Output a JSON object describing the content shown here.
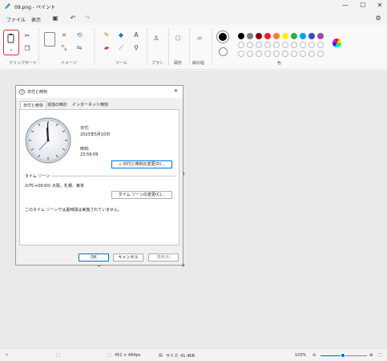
{
  "window": {
    "title": "09.png - ペイント",
    "minimize": "—",
    "maximize": "☐",
    "close": "✕"
  },
  "menu": {
    "file": "ファイル",
    "view": "表示"
  },
  "ribbon": {
    "groups": {
      "clipboard": "クリップボード",
      "image": "イメージ",
      "tools": "ツール",
      "brushes": "ブラシ",
      "shapes": "図形",
      "size": "線の幅",
      "colors": "色"
    },
    "palette_row1": [
      "#000000",
      "#7f7f7f",
      "#880015",
      "#ed1c24",
      "#ff7f27",
      "#fff200",
      "#22b14c",
      "#00a2e8",
      "#3f48cc",
      "#a349a4"
    ],
    "palette_row2_empty_count": 10
  },
  "dialog": {
    "title": "日付と時刻",
    "close": "✕",
    "tabs": [
      "日付と時刻",
      "追加の時計",
      "インターネット時刻"
    ],
    "date_label": "日付:",
    "date_value": "2023年5月10日",
    "time_label": "時刻:",
    "time_value": "23:59:09",
    "change_datetime_button": "日付と時刻の変更(D)...",
    "timezone_section": "タイム ゾーン",
    "timezone_value": "(UTC+09:00) 大阪、札幌、東京",
    "change_timezone_button": "タイム ゾーンの変更(C)...",
    "dst_note": "このタイム ゾーンでは夏時間は実施されていません。",
    "ok": "OK",
    "cancel": "キャンセル",
    "apply": "適用(A)"
  },
  "status": {
    "dimensions": "451 × 464px",
    "size": "サイズ: 41.4KB",
    "zoom": "100%"
  }
}
